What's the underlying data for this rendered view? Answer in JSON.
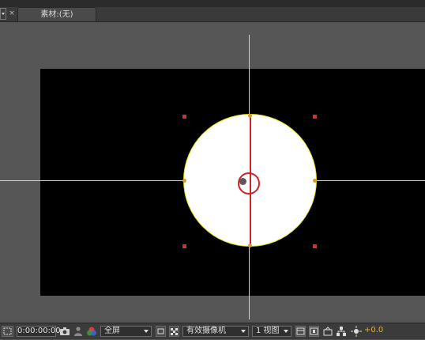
{
  "panel": {
    "close_glyph": "×",
    "tab_label": "素材:(无)"
  },
  "statusbar": {
    "timecode": "0:00:00:00",
    "resolution": "全屏",
    "camera": "有效摄像机",
    "views": "1 视图",
    "exposure": "+0.0"
  },
  "icons": {
    "menu": "panel-menu-icon",
    "snapshot": "camera-icon",
    "show_snapshot": "person-icon",
    "channels": "color-channels-icon",
    "region": "region-of-interest-icon",
    "transparency": "transparency-grid-icon",
    "layout": "layout-icon",
    "toggle_3d": "3d-view-icon",
    "reset_exposure": "reset-exposure-icon",
    "flowchart": "flowchart-icon",
    "fast_preview": "fast-preview-icon"
  },
  "colors": {
    "guide": "#cfcfcf",
    "shape_fill": "#ffffff",
    "shape_stroke": "#e8e61a",
    "selection": "#d22027",
    "exposure_text": "#e2b233"
  }
}
